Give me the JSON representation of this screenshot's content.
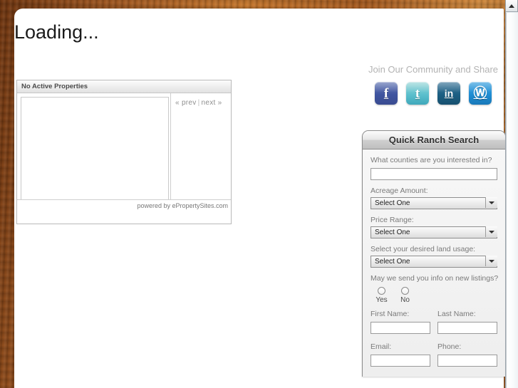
{
  "page": {
    "heading": "Loading..."
  },
  "properties_widget": {
    "header_title": "No Active Properties",
    "pager": {
      "prev_label": "« prev",
      "separator": "|",
      "next_label": "next »"
    },
    "footer_text": "powered by ePropertySites.com"
  },
  "sidebar": {
    "community_title": "Join Our Community and Share",
    "social_icons": [
      {
        "name": "facebook-icon",
        "glyph": "f",
        "color": "#3f54a0"
      },
      {
        "name": "twitter-icon",
        "glyph": "t",
        "color": "#5cc0cd"
      },
      {
        "name": "linkedin-icon",
        "glyph": "in",
        "color": "#1c5f83"
      },
      {
        "name": "wordpress-icon",
        "glyph": "Ⓦ",
        "color": "#1f8ed4"
      }
    ]
  },
  "ranch_search": {
    "panel_title": "Quick Ranch Search",
    "counties": {
      "label": "What counties are you interested in?",
      "value": "",
      "placeholder": ""
    },
    "acreage": {
      "label": "Acreage Amount:",
      "selected": "Select One"
    },
    "price_range": {
      "label": "Price Range:",
      "selected": "Select One"
    },
    "land_usage": {
      "label": "Select your desired land usage:",
      "selected": "Select One"
    },
    "new_listings": {
      "label": "May we send you info on new listings?",
      "options": [
        {
          "label": "Yes",
          "checked": false
        },
        {
          "label": "No",
          "checked": false
        }
      ]
    },
    "first_name": {
      "label": "First Name:",
      "value": ""
    },
    "last_name": {
      "label": "Last Name:",
      "value": ""
    },
    "email": {
      "label": "Email:",
      "value": ""
    },
    "phone": {
      "label": "Phone:",
      "value": ""
    }
  },
  "scrollbar": {
    "up_arrow": "scroll-up-arrow"
  },
  "colors": {
    "background_brown": "#9c5520",
    "panel_white": "#ffffff",
    "muted_text": "#b3b3b3",
    "label_text": "#7a7a7a"
  }
}
